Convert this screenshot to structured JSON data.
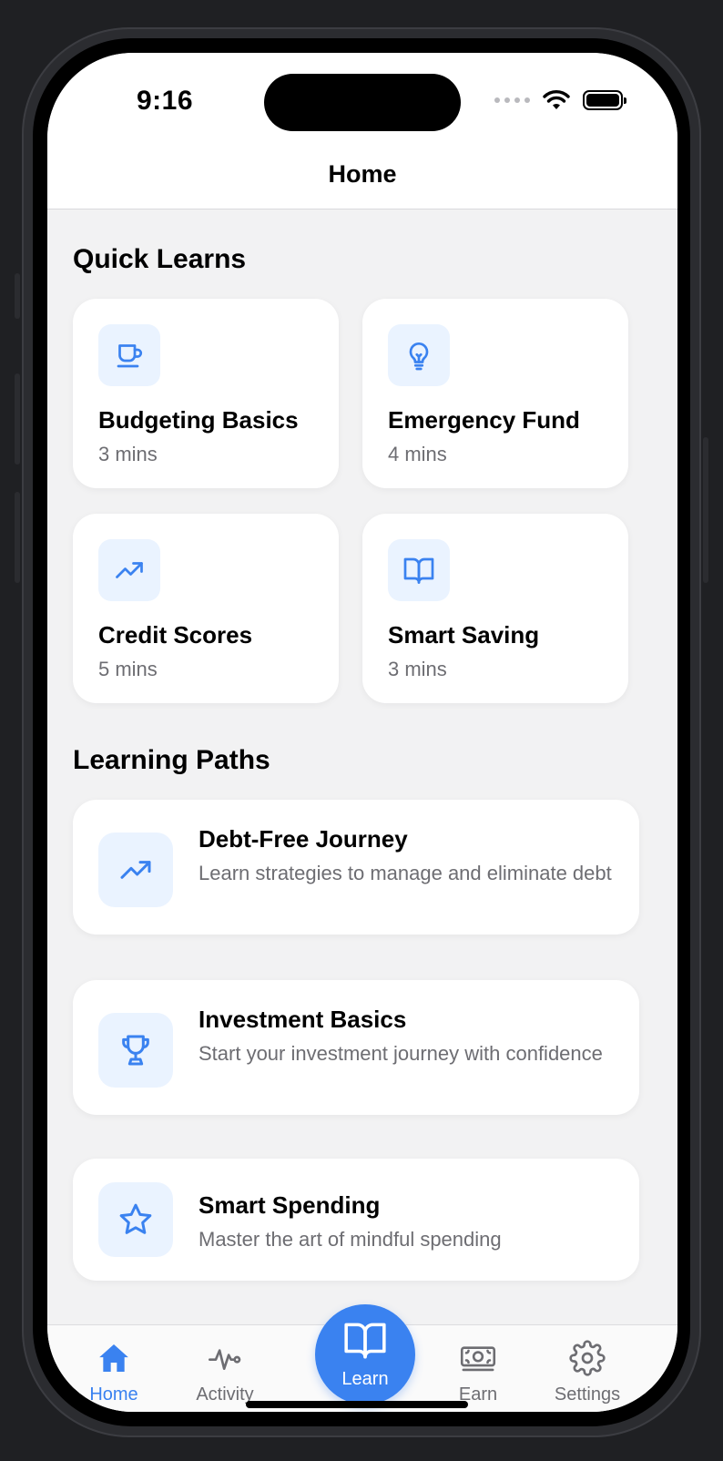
{
  "status_bar": {
    "time": "9:16"
  },
  "nav": {
    "title": "Home"
  },
  "quick_learns": {
    "heading": "Quick Learns",
    "items": [
      {
        "title": "Budgeting Basics",
        "duration": "3 mins",
        "icon": "cup-icon"
      },
      {
        "title": "Emergency Fund",
        "duration": "4 mins",
        "icon": "lightbulb-icon"
      },
      {
        "title": "Credit Scores",
        "duration": "5 mins",
        "icon": "trending-up-icon"
      },
      {
        "title": "Smart Saving",
        "duration": "3 mins",
        "icon": "book-icon"
      }
    ]
  },
  "learning_paths": {
    "heading": "Learning Paths",
    "items": [
      {
        "title": "Debt-Free Journey",
        "description": "Learn strategies to manage and eliminate debt",
        "icon": "trending-up-icon"
      },
      {
        "title": "Investment Basics",
        "description": "Start your investment journey with confidence",
        "icon": "trophy-icon"
      },
      {
        "title": "Smart Spending",
        "description": "Master the art of mindful spending",
        "icon": "star-icon"
      }
    ]
  },
  "tabbar": {
    "home": "Home",
    "activity": "Activity",
    "learn": "Learn",
    "earn": "Earn",
    "settings": "Settings"
  },
  "colors": {
    "accent": "#3a82f0",
    "icon_bg": "#eaf3ff",
    "background": "#f2f2f3"
  }
}
